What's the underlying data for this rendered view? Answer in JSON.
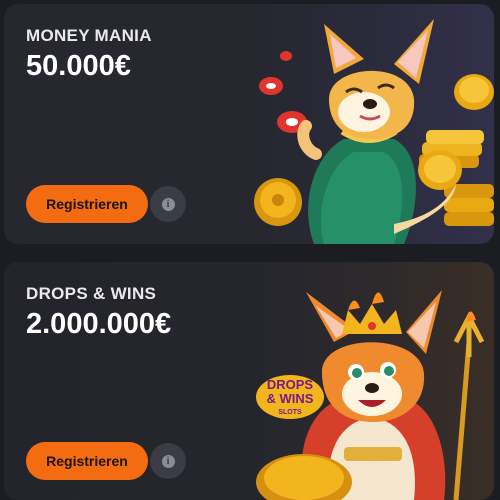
{
  "promotions": [
    {
      "title": "MONEY MANIA",
      "amount": "50.000€",
      "cta_label": "Registrieren",
      "info_icon": "info-icon",
      "art": "fox-with-coins-illustration"
    },
    {
      "title": "DROPS & WINS",
      "amount": "2.000.000€",
      "cta_label": "Registrieren",
      "info_icon": "info-icon",
      "art": "king-corgi-illustration",
      "art_badge": {
        "line1": "DROPS",
        "line2": "& WINS",
        "line3": "SLOTS"
      }
    }
  ],
  "colors": {
    "cta": "#f36c12",
    "card": "#26272f",
    "background": "#1c1d22",
    "coin": "#f2b51e"
  }
}
